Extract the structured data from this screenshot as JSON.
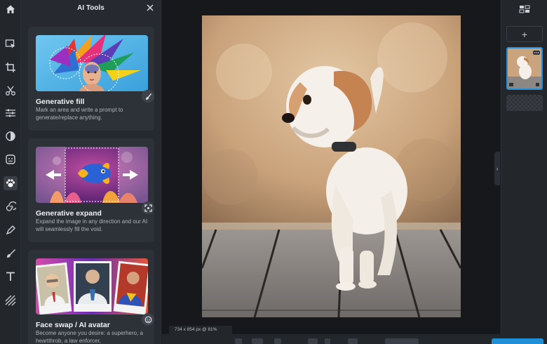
{
  "panel": {
    "title": "AI Tools"
  },
  "cards": [
    {
      "title": "Generative fill",
      "description": "Mark an area and write a prompt to generate/replace anything.",
      "badge_icon": "brush-icon"
    },
    {
      "title": "Generative expand",
      "description": "Expand the image in any direction and our AI will seamlessly fill the void.",
      "badge_icon": "expand-icon"
    },
    {
      "title": "Face swap / AI avatar",
      "description": "Become anyone you desire: a superhero, a heartthrob, a law enforcer,",
      "badge_icon": "face-icon"
    }
  ],
  "canvas": {
    "info": "734 x 854 px @ 81%"
  },
  "rail_tools": [
    "arrange-icon",
    "crop-icon",
    "cut-icon",
    "adjust-icon",
    "effects-icon",
    "ai-tools-icon",
    "paw-icon",
    "liquify-icon",
    "draw-icon",
    "retouch-icon",
    "text-icon",
    "texture-icon"
  ],
  "colors": {
    "accent": "#2a8ed6",
    "panel": "#262a30",
    "card": "#2d3138",
    "canvas": "#16181b"
  }
}
